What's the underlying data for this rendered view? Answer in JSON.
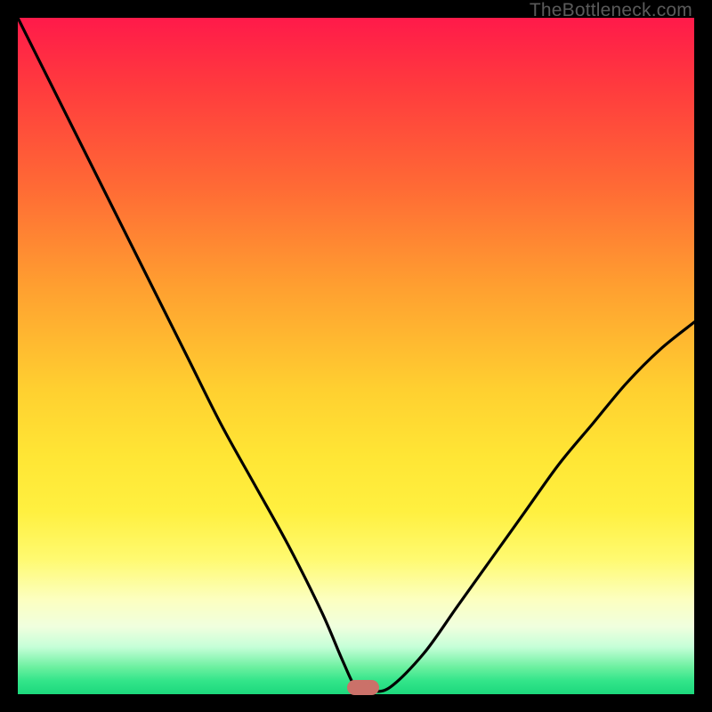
{
  "watermark": "TheBottleneck.com",
  "colors": {
    "frame": "#000000",
    "curve": "#000000",
    "marker": "#cb7169",
    "gradient_top": "#ff1a4a",
    "gradient_bottom": "#1cd87c"
  },
  "chart_data": {
    "type": "line",
    "title": "",
    "xlabel": "",
    "ylabel": "",
    "xlim": [
      0,
      100
    ],
    "ylim": [
      0,
      100
    ],
    "grid": false,
    "legend": false,
    "note": "Background is a vertical red→yellow→green gradient. Curve is a black V-shaped line. Values are estimated from pixels (no axis labels shown).",
    "series": [
      {
        "name": "curve",
        "x": [
          0,
          5,
          10,
          15,
          20,
          25,
          30,
          35,
          40,
          45,
          48,
          50,
          52,
          55,
          60,
          65,
          70,
          75,
          80,
          85,
          90,
          95,
          100
        ],
        "y": [
          100,
          90,
          80,
          70,
          60,
          50,
          40,
          31,
          22,
          12,
          5,
          1,
          0.5,
          1,
          6,
          13,
          20,
          27,
          34,
          40,
          46,
          51,
          55
        ]
      }
    ],
    "marker": {
      "x": 51,
      "y": 0.5,
      "shape": "rounded-rect"
    }
  }
}
